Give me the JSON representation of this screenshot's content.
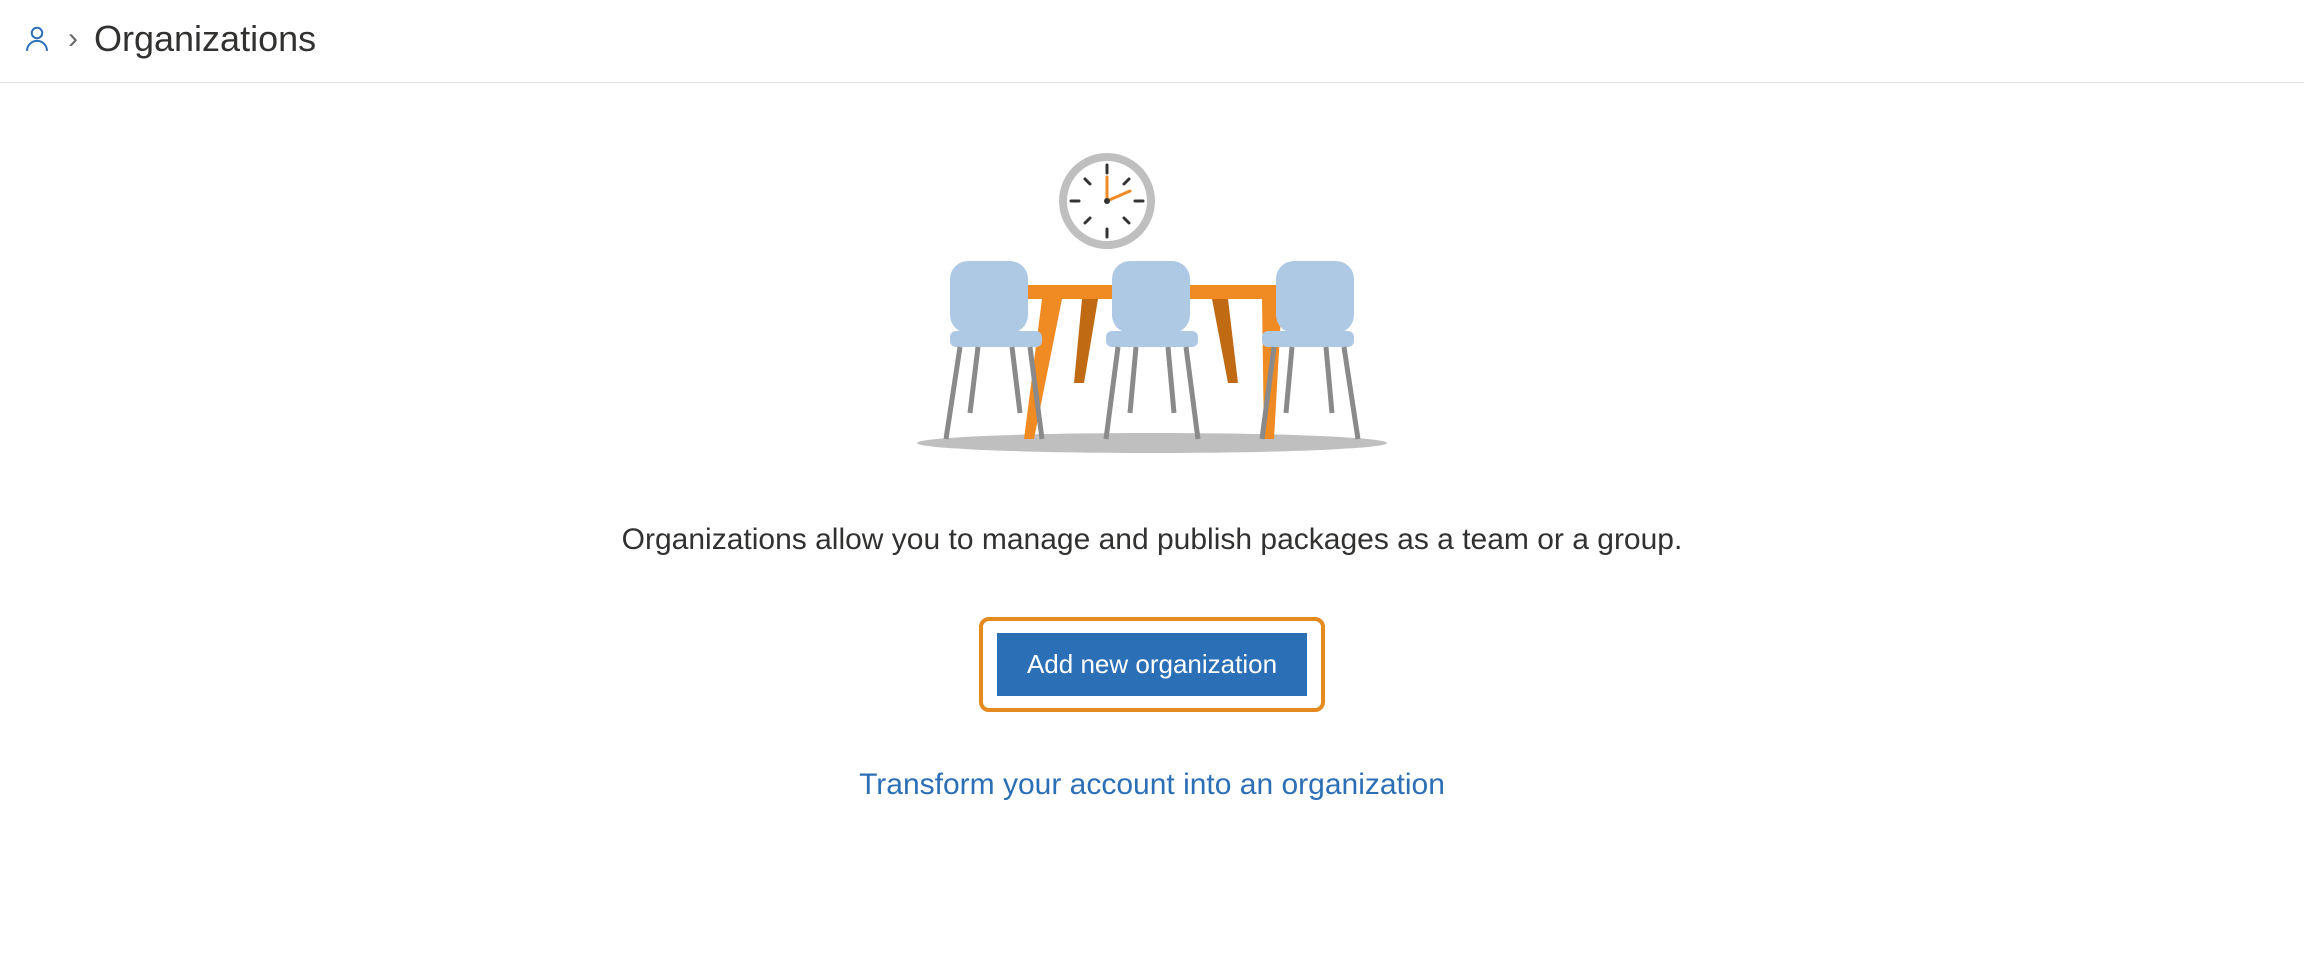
{
  "breadcrumb": {
    "current": "Organizations"
  },
  "main": {
    "description": "Organizations allow you to manage and publish packages as a team or a group.",
    "add_button_label": "Add new organization",
    "transform_link_label": "Transform your account into an organization"
  }
}
